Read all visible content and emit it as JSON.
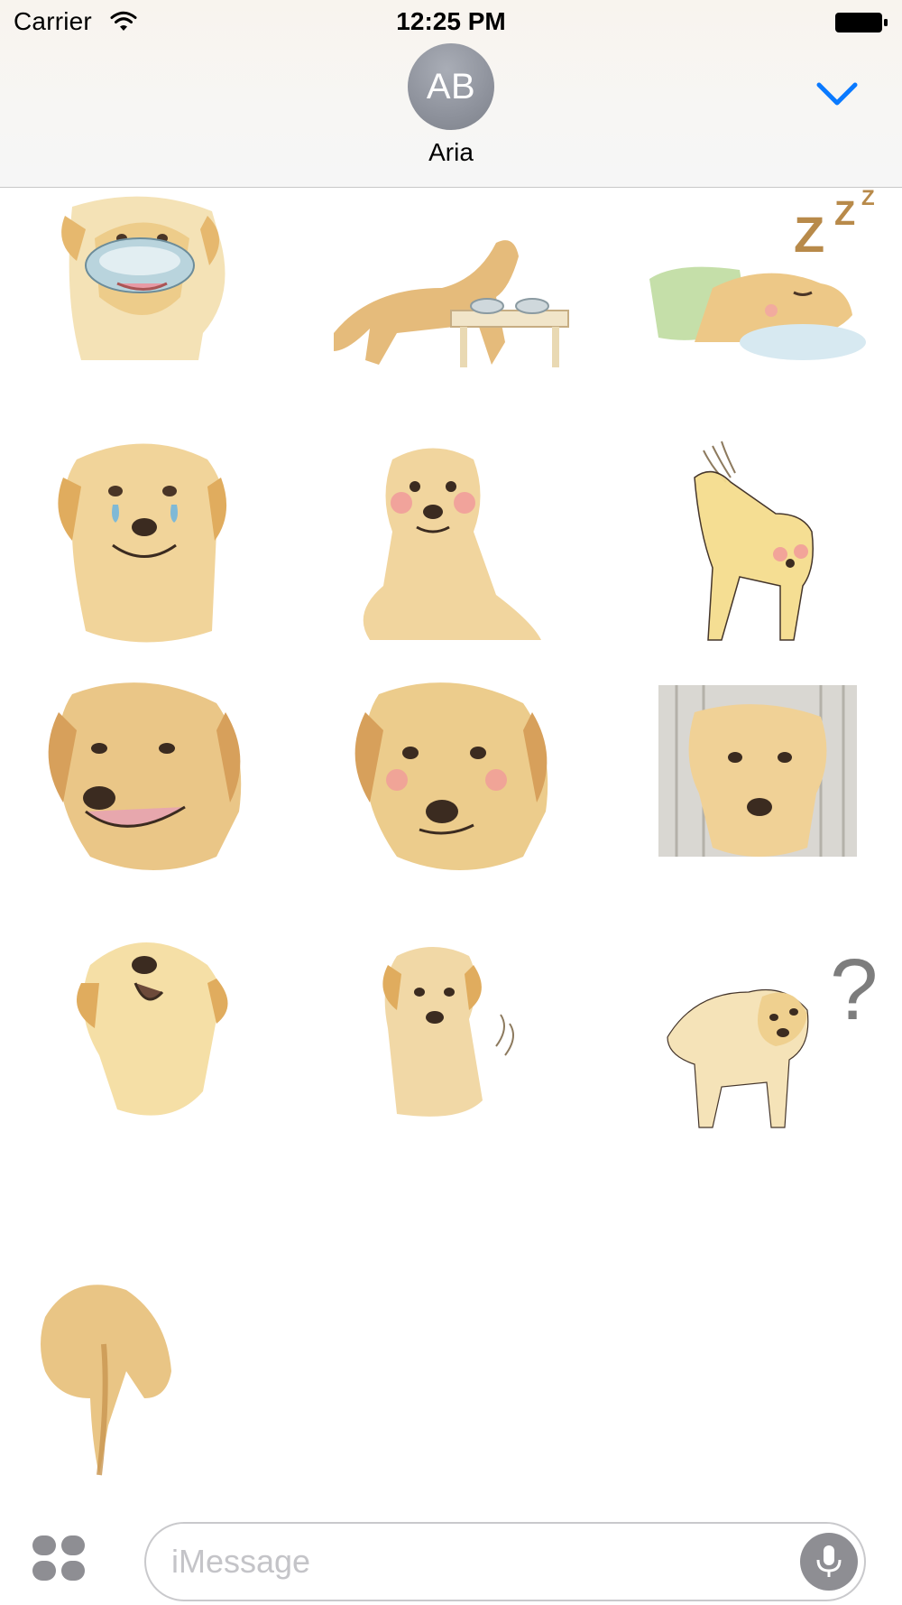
{
  "status_bar": {
    "carrier": "Carrier",
    "time": "12:25 PM"
  },
  "contact": {
    "initials": "AB",
    "name": "Aria"
  },
  "header": {
    "collapse_icon": "chevron-down-icon",
    "accent_color": "#0a7aff"
  },
  "stickers": [
    {
      "name": "dog-with-bowl-in-mouth"
    },
    {
      "name": "dog-eating-at-table"
    },
    {
      "name": "dog-sleeping-zzz"
    },
    {
      "name": "dog-crying"
    },
    {
      "name": "dog-blushing"
    },
    {
      "name": "dog-shaking"
    },
    {
      "name": "dog-smiling"
    },
    {
      "name": "dog-blushing-face"
    },
    {
      "name": "dog-gloomy"
    },
    {
      "name": "dog-howling"
    },
    {
      "name": "dog-sitting-wagging"
    },
    {
      "name": "dog-question"
    },
    {
      "name": "dog-tail-back"
    }
  ],
  "input": {
    "placeholder": "iMessage",
    "apps_icon": "app-drawer-icon",
    "mic_icon": "microphone-icon"
  }
}
